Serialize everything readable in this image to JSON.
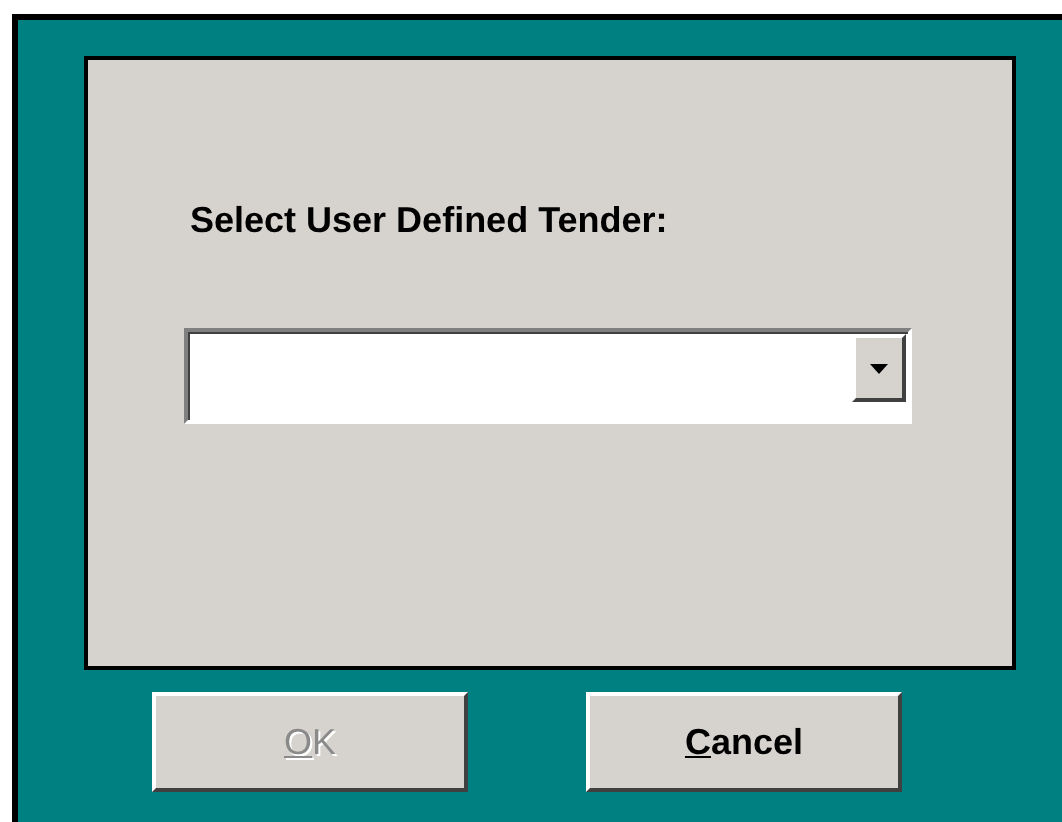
{
  "dialog": {
    "prompt": "Select User Defined Tender:"
  },
  "buttons": [
    {
      "mnemonic": "O",
      "label_rest": "K",
      "disabled": true
    },
    {
      "mnemonic": "C",
      "label_rest": "ancel",
      "disabled": false
    }
  ]
}
